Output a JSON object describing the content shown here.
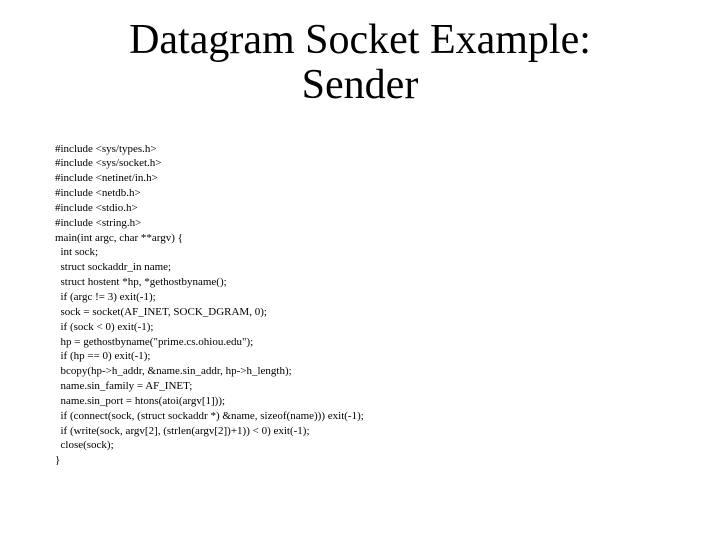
{
  "title_line1": "Datagram Socket Example:",
  "title_line2": "Sender",
  "code": {
    "l0": "#include <sys/types.h>",
    "l1": "#include <sys/socket.h>",
    "l2": "#include <netinet/in.h>",
    "l3": "#include <netdb.h>",
    "l4": "#include <stdio.h>",
    "l5": "#include <string.h>",
    "l6": "main(int argc, char **argv) {",
    "l7": "  int sock;",
    "l8": "  struct sockaddr_in name;",
    "l9": "  struct hostent *hp, *gethostbyname();",
    "l10": "  if (argc != 3) exit(-1);",
    "l11": "  sock = socket(AF_INET, SOCK_DGRAM, 0);",
    "l12": "  if (sock < 0) exit(-1);",
    "l13": "  hp = gethostbyname(\"prime.cs.ohiou.edu\");",
    "l14": "  if (hp == 0) exit(-1);",
    "l15": "  bcopy(hp->h_addr, &name.sin_addr, hp->h_length);",
    "l16": "  name.sin_family = AF_INET;",
    "l17": "  name.sin_port = htons(atoi(argv[1]));",
    "l18": "  if (connect(sock, (struct sockaddr *) &name, sizeof(name))) exit(-1);",
    "l19": "  if (write(sock, argv[2], (strlen(argv[2])+1)) < 0) exit(-1);",
    "l20": "  close(sock);",
    "l21": "}"
  }
}
